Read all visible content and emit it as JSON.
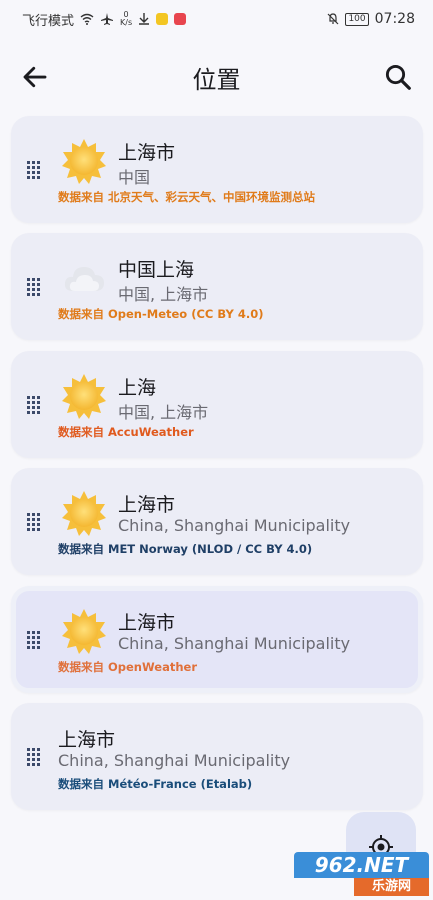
{
  "status_bar": {
    "mode": "飞行模式",
    "speed_value": "0",
    "speed_unit": "K/s",
    "battery": "100",
    "time": "07:28"
  },
  "appbar": {
    "title": "位置",
    "back_icon": "arrow-left-icon",
    "search_icon": "search-icon"
  },
  "locations": [
    {
      "name": "上海市",
      "subtitle": "中国",
      "source": "数据来自 北京天气、彩云天气、中国环境监测总站",
      "source_color": "#e07b1a",
      "icon": "sun-icon"
    },
    {
      "name": "中国上海",
      "subtitle": "中国, 上海市",
      "source": "数据来自 Open-Meteo (CC BY 4.0)",
      "source_color": "#e07b1a",
      "icon": "cloud-icon"
    },
    {
      "name": "上海",
      "subtitle": "中国, 上海市",
      "source": "数据来自 AccuWeather",
      "source_color": "#e05a1e",
      "icon": "sun-icon"
    },
    {
      "name": "上海市",
      "subtitle": "China, Shanghai Municipality",
      "source": "数据来自 MET Norway (NLOD / CC BY 4.0)",
      "source_color": "#1f3f66",
      "icon": "sun-icon"
    },
    {
      "name": "上海市",
      "subtitle": "China, Shanghai Municipality",
      "source": "数据来自 OpenWeather",
      "source_color": "#e0703a",
      "icon": "sun-icon"
    },
    {
      "name": "上海市",
      "subtitle": "China, Shanghai Municipality",
      "source": "数据来自 Météo-France (Etalab)",
      "source_color": "#1a4d7a",
      "icon": ""
    }
  ],
  "fab": {
    "icon": "my-location-icon"
  },
  "watermark": {
    "brand": "962.NET",
    "sub": "乐游网"
  },
  "colors": {
    "card_bg": "#ecedf6",
    "selected_bg": "#e4e5f7",
    "sun": "#f6c343"
  }
}
